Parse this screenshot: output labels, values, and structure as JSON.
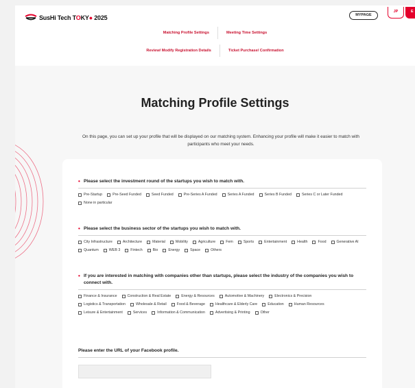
{
  "header": {
    "logo_text_a": "SusHi Tech T",
    "logo_text_o": "O",
    "logo_text_b": "KY",
    "logo_text_c": " 2025",
    "mypage": "MYPAGE",
    "lang_jp": "JP",
    "lang_en": "E"
  },
  "nav": {
    "row1": [
      "Matching Profile Settings",
      "Meeting Time Settings"
    ],
    "row2": [
      "Review/ Modify Registration Details",
      "Ticket Purchase/ Confirmation"
    ]
  },
  "page": {
    "title": "Matching Profile Settings",
    "intro": "On this page, you can set up your profile that will be displayed on our matching system. Enhancing your profile will make it easier to match with participants who meet your needs."
  },
  "sections": {
    "investment": {
      "question": "Please select the investment round of the startups you wish to match with.",
      "options": [
        "Pre-Startup",
        "Pre-Seed Funded",
        "Seed Funded",
        "Pre-Series A Funded",
        "Series A Funded",
        "Series B Funded",
        "Series C or Later Funded",
        "None in particular"
      ]
    },
    "sector": {
      "question": "Please select the business sector of the startups you wish to match with.",
      "options": [
        "City Infrastructure",
        "Architecture",
        "Material",
        "Mobility",
        "Agriculture",
        "Fem",
        "Sports",
        "Entertainment",
        "Health",
        "Food",
        "Generative AI",
        "Quantum",
        "WEB 3",
        "Fintech",
        "Bio",
        "Energy",
        "Space",
        "Others"
      ]
    },
    "industry": {
      "question": "If you are interested in matching with companies other than startups, please select the industry of the companies you wish to connect with.",
      "options": [
        "Finance & Insurance",
        "Construction & Real Estate",
        "Energy & Resources",
        "Automotive & Machinery",
        "Electronics & Precision",
        "Logistics & Transportation",
        "Wholesale & Retail",
        "Food & Beverage",
        "Healthcare & Elderly Care",
        "Education",
        "Human Resources",
        "Leisure & Entertainment",
        "Services",
        "Information & Communication",
        "Advertising & Printing",
        "Other"
      ]
    },
    "facebook": {
      "question": "Please enter the URL of your Facebook profile.",
      "value": ""
    }
  },
  "colors": {
    "accent": "#e4002b",
    "nav_link": "#c8102e"
  }
}
